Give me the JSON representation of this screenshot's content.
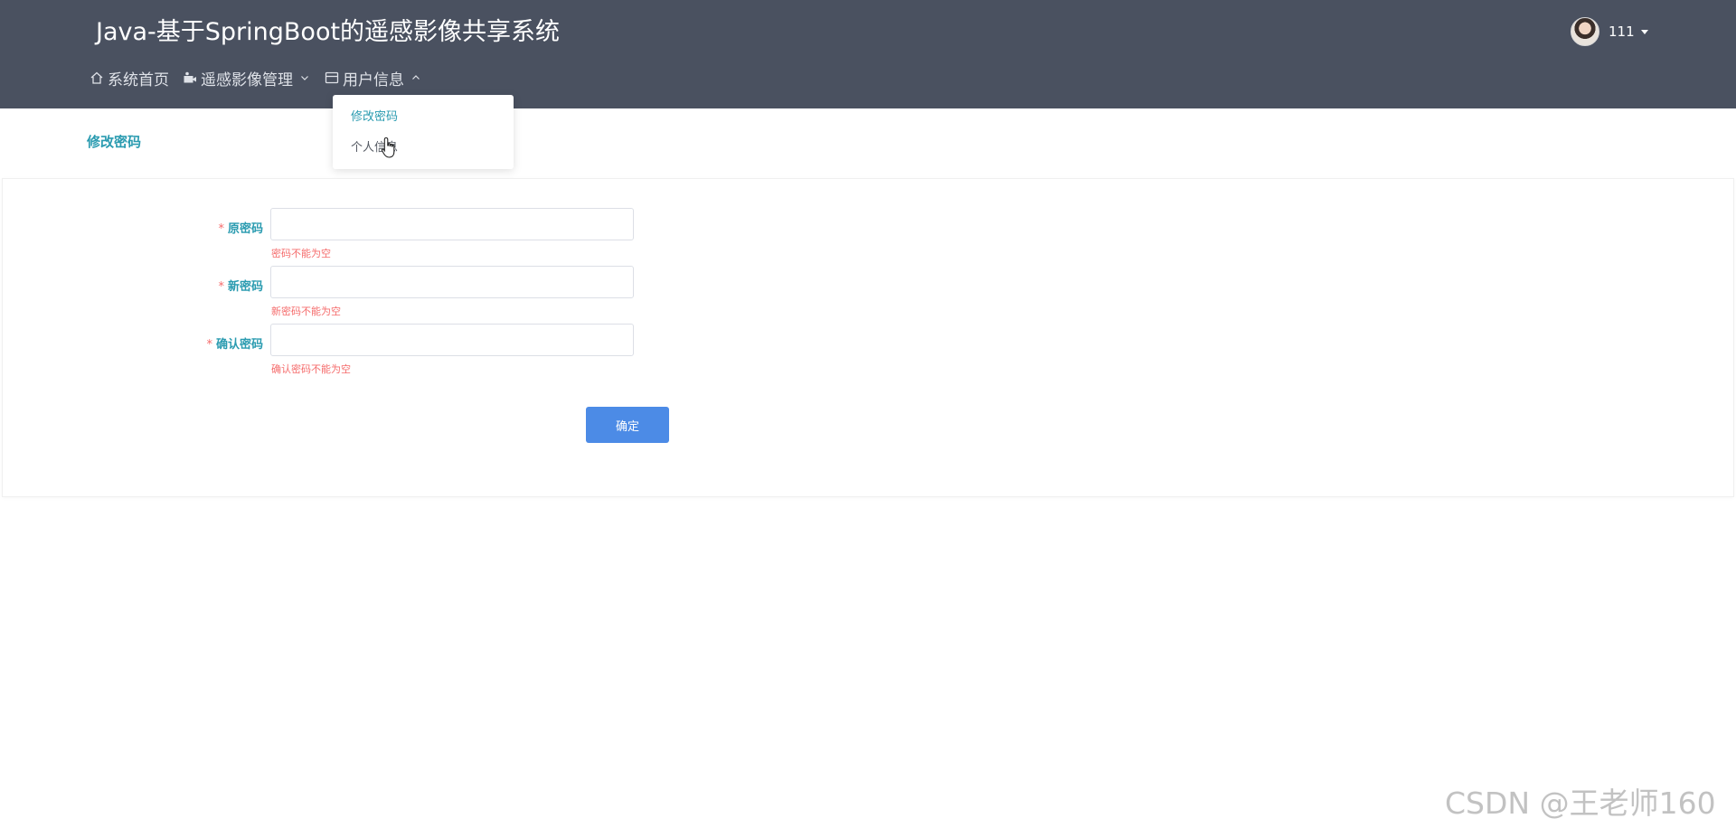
{
  "header": {
    "title": "Java-基于SpringBoot的遥感影像共享系统",
    "nav": [
      {
        "label": "系统首页",
        "icon": "home-icon"
      },
      {
        "label": "遥感影像管理",
        "icon": "camera-icon",
        "chevron": "chevron-down-icon"
      },
      {
        "label": "用户信息",
        "icon": "card-icon",
        "chevron": "chevron-up-icon"
      }
    ],
    "user": {
      "name": "111",
      "avatar": "avatar-photo"
    }
  },
  "dropdown": {
    "items": [
      {
        "label": "修改密码",
        "active": true
      },
      {
        "label": "个人信息",
        "active": false
      }
    ]
  },
  "page": {
    "heading": "修改密码"
  },
  "form": {
    "required_mark": "*",
    "fields": [
      {
        "label": "原密码",
        "value": "",
        "error": "密码不能为空"
      },
      {
        "label": "新密码",
        "value": "",
        "error": "新密码不能为空"
      },
      {
        "label": "确认密码",
        "value": "",
        "error": "确认密码不能为空"
      }
    ],
    "submit_label": "确定"
  },
  "watermark": "CSDN @王老师160",
  "colors": {
    "header_bg": "#4a5160",
    "accent": "#2a9bb0",
    "error": "#f56c6c",
    "button": "#4c8be6"
  }
}
